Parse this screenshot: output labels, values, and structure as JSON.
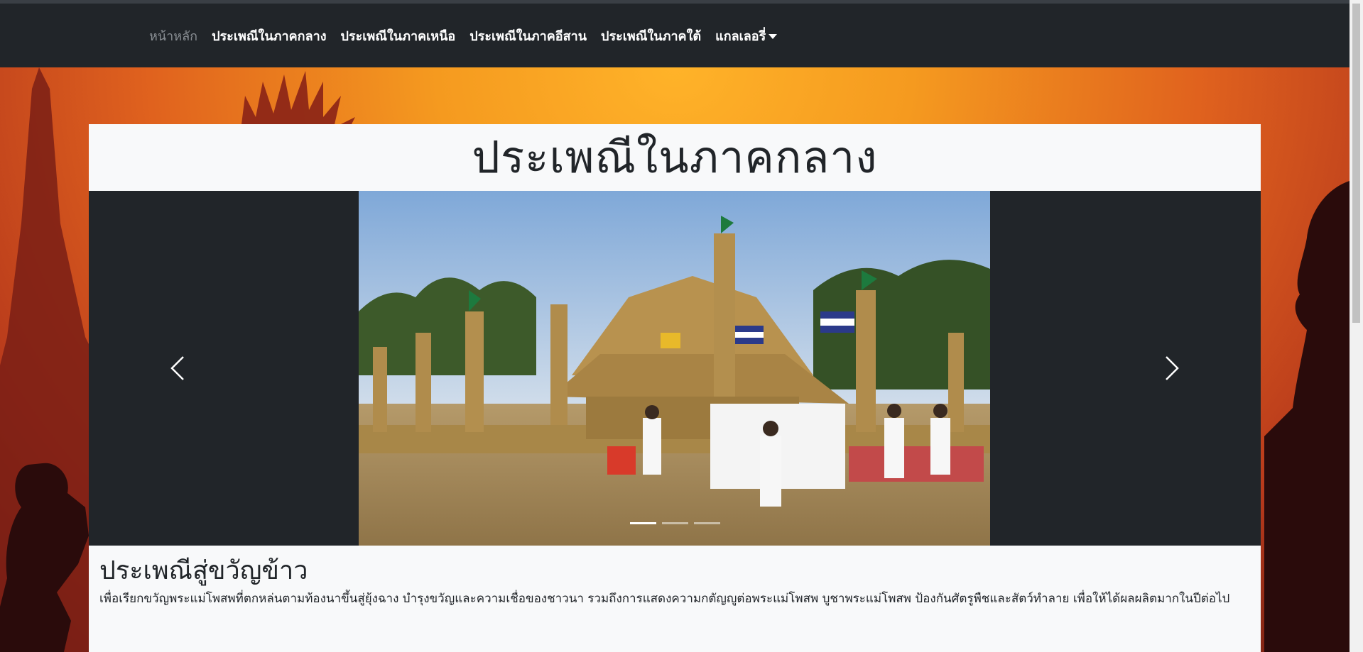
{
  "nav": {
    "items": [
      {
        "label": "หน้าหลัก",
        "active": false
      },
      {
        "label": "ประเพณีในภาคกลาง"
      },
      {
        "label": "ประเพณีในภาคเหนือ"
      },
      {
        "label": "ประเพณีในภาคอีสาน"
      },
      {
        "label": "ประเพณีในภาคใต้"
      },
      {
        "label": "แกลเลอรี่"
      }
    ],
    "dropdown_icon": "caret-down-icon"
  },
  "page": {
    "title": "ประเพณีในภาคกลาง"
  },
  "carousel": {
    "prev_icon": "chevron-left-icon",
    "next_icon": "chevron-right-icon",
    "slide_count": 3,
    "active_index": 0
  },
  "article": {
    "heading": "ประเพณีสู่ขวัญข้าว",
    "body": "เพื่อเรียกขวัญพระแม่โพสพที่ตกหล่นตามท้องนาขึ้นสู่ยุ้งฉาง บำรุงขวัญและความเชื่อของชาวนา รวมถึงการแสดงความกตัญญูต่อพระแม่โพสพ บูชาพระแม่โพสพ ป้องกันศัตรูพืชและสัตว์ทำลาย เพื่อให้ได้ผลผลิตมากในปีต่อไป"
  },
  "colors": {
    "navbar": "#212529",
    "card": "#f8f9fa",
    "carousel_bg": "#212529",
    "background_glow": "#ffb329"
  }
}
